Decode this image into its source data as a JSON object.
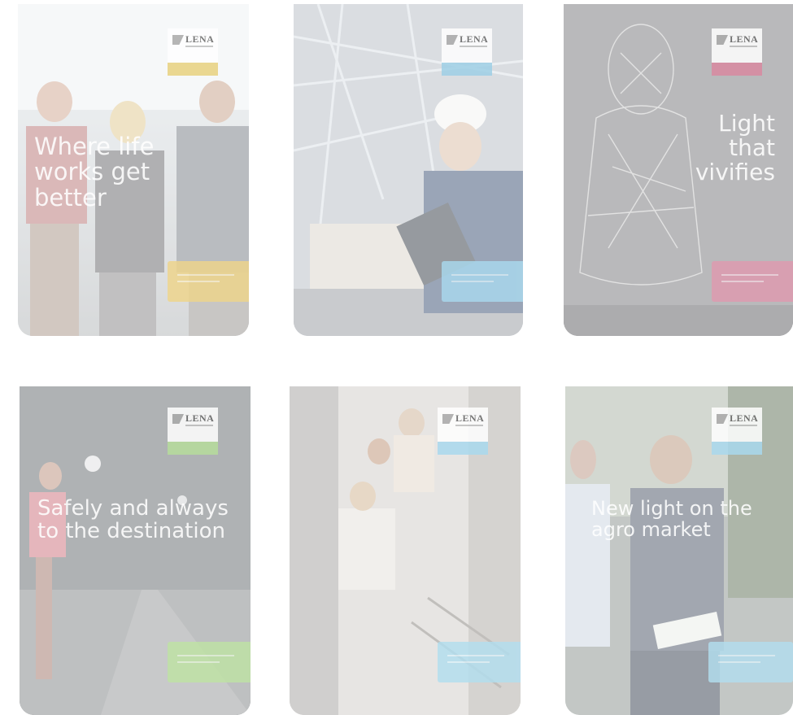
{
  "brand": {
    "name": "LENA",
    "accent_yellow": "#e9d27f",
    "accent_blue": "#9fd0e6",
    "accent_red": "#d98aa1",
    "accent_green": "#b7dd9c"
  },
  "cards": [
    {
      "id": "office",
      "headline": "Where life works get better",
      "tag_color": "#e9d27f",
      "cta_color": "#efd58a"
    },
    {
      "id": "industry",
      "headline": "",
      "tag_color": "#9fd0e6",
      "cta_color": "#a9d9ee"
    },
    {
      "id": "architecture",
      "headline": "Light that vivifies",
      "tag_color": "#d98aa1",
      "cta_color": "#e09ab0"
    },
    {
      "id": "road",
      "headline": "Safely and always to the destination",
      "tag_color": "#b7dd9c",
      "cta_color": "#bfe3a4"
    },
    {
      "id": "home",
      "headline": "",
      "tag_color": "#a9d9ee",
      "cta_color": "#b2deef"
    },
    {
      "id": "agro",
      "headline": "New light on the agro market",
      "tag_color": "#a9d9ee",
      "cta_color": "#b2deef"
    }
  ]
}
